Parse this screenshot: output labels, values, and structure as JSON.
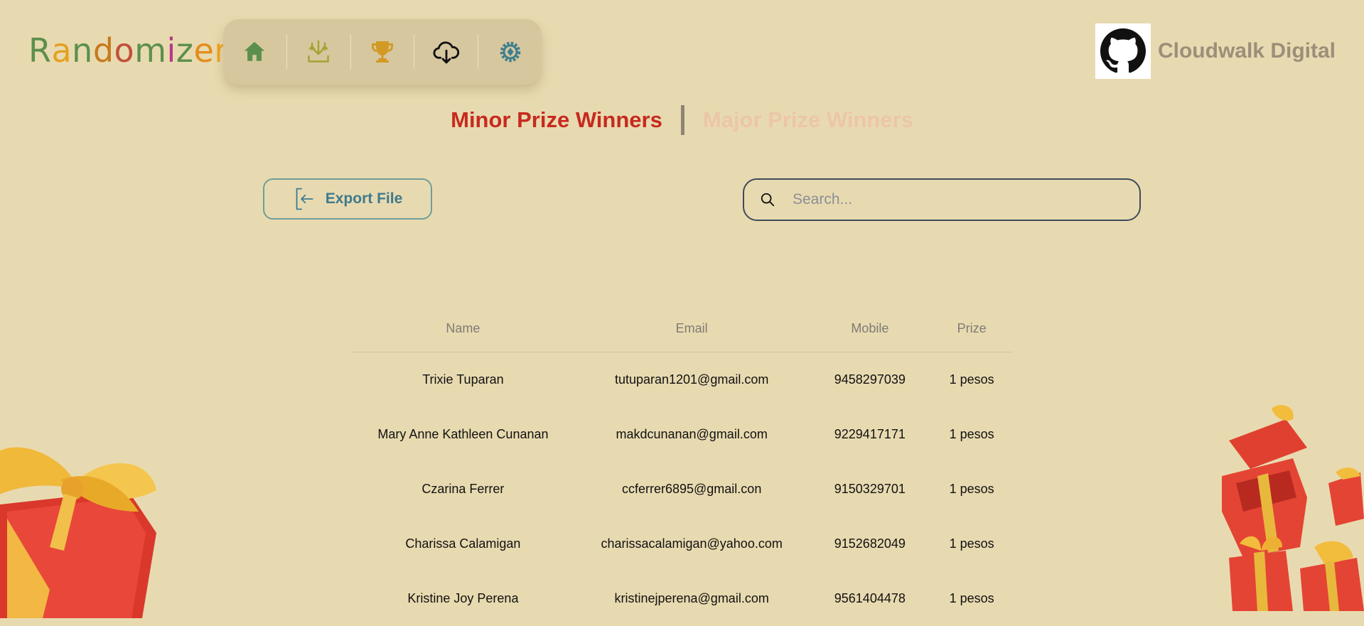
{
  "app": {
    "logo_letters": [
      {
        "ch": "R",
        "color": "#5c8f4e"
      },
      {
        "ch": "a",
        "color": "#e4a020"
      },
      {
        "ch": "n",
        "color": "#5c8f4e"
      },
      {
        "ch": "d",
        "color": "#c67a1d"
      },
      {
        "ch": "o",
        "color": "#c0503b"
      },
      {
        "ch": "m",
        "color": "#5c8f4e"
      },
      {
        "ch": "i",
        "color": "#b6388a"
      },
      {
        "ch": "z",
        "color": "#5c8f4e"
      },
      {
        "ch": "e",
        "color": "#e38d1c"
      },
      {
        "ch": "r",
        "color": "#f0a41f"
      }
    ],
    "logo_text": "Randomizer"
  },
  "nav": {
    "items": [
      {
        "icon": "home-icon",
        "color": "#5c8f4e"
      },
      {
        "icon": "import-icon",
        "color": "#a8a02e"
      },
      {
        "icon": "trophy-icon",
        "color": "#d29a24"
      },
      {
        "icon": "cloud-download-icon",
        "color": "#111111"
      },
      {
        "icon": "gear-icon",
        "color": "#3f7f8e"
      }
    ]
  },
  "brand": {
    "name": "Cloudwalk Digital",
    "icon": "github-icon"
  },
  "tabs": {
    "minor": "Minor Prize Winners",
    "major": "Major Prize Winners",
    "active": "minor"
  },
  "toolbar": {
    "export_label": "Export File",
    "search_placeholder": "Search...",
    "search_value": ""
  },
  "table": {
    "headers": [
      "Name",
      "Email",
      "Mobile",
      "Prize"
    ],
    "rows": [
      [
        "Trixie Tuparan",
        "tutuparan1201@gmail.com",
        "9458297039",
        "1 pesos"
      ],
      [
        "Mary Anne Kathleen Cunanan",
        "makdcunanan@gmail.com",
        "9229417171",
        "1 pesos"
      ],
      [
        "Czarina Ferrer",
        "ccferrer6895@gmail.con",
        "9150329701",
        "1 pesos"
      ],
      [
        "Charissa Calamigan",
        "charissacalamigan@yahoo.com",
        "9152682049",
        "1 pesos"
      ],
      [
        "Kristine Joy Perena",
        "kristinejperena@gmail.com",
        "9561404478",
        "1 pesos"
      ]
    ]
  },
  "colors": {
    "background": "#e8dab0",
    "accent_red": "#c62a1f",
    "teal": "#3f7a8c"
  }
}
